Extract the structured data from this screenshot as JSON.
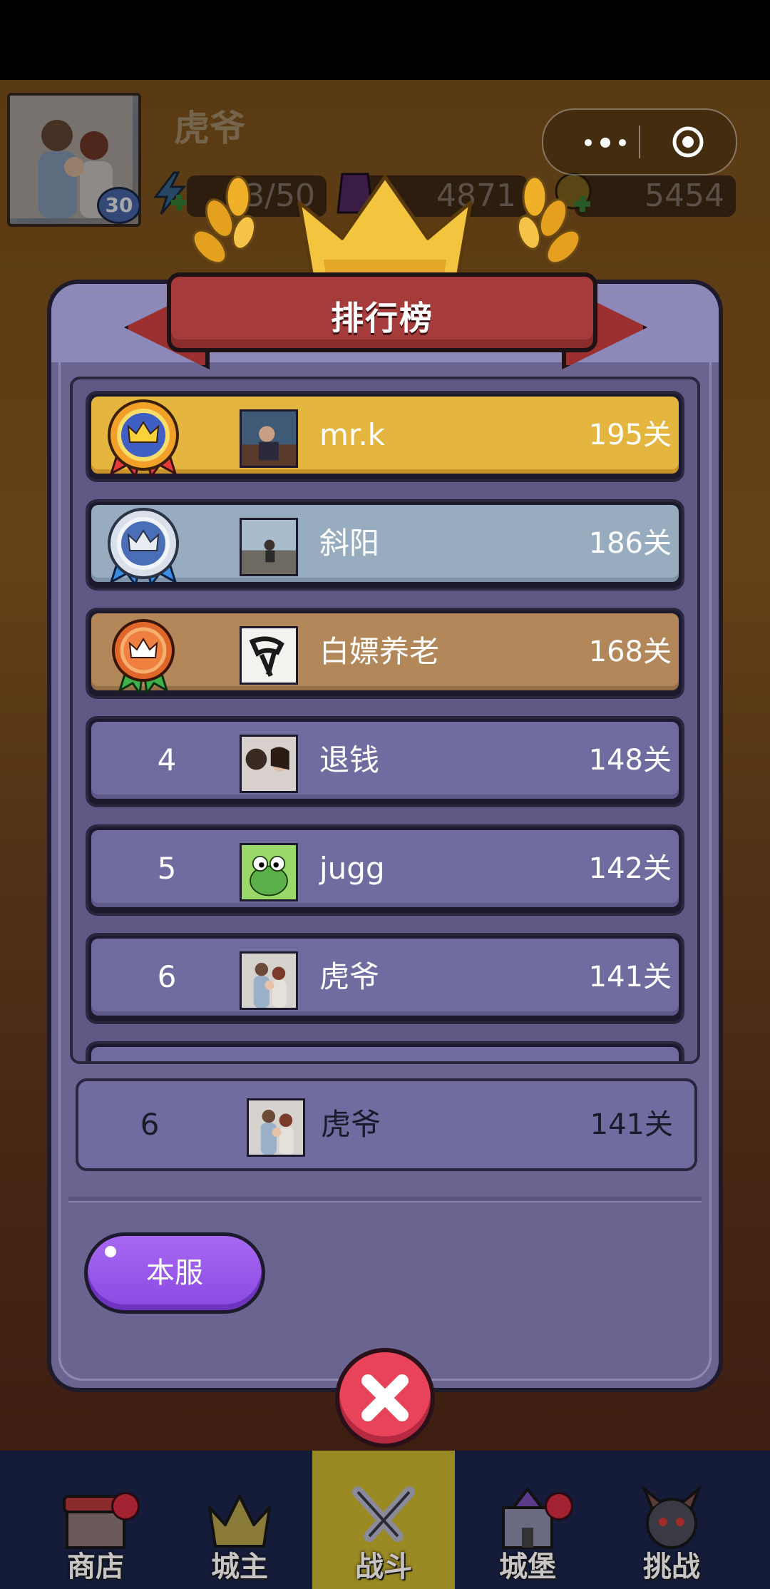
{
  "header": {
    "player_name": "虎爷",
    "level": "30",
    "energy": "3/50",
    "gems": "4871",
    "coins": "5454",
    "energy_icon": "lightning-plus-icon",
    "gem_icon": "gem-icon",
    "coin_icon": "coin-plus-icon"
  },
  "capsule": {
    "more_icon": "more-dots-icon",
    "close_icon": "target-circle-icon"
  },
  "modal": {
    "title": "排行榜",
    "tab_button": "本服",
    "close_icon": "close-x-icon",
    "rows": [
      {
        "rank": "1",
        "rank_icon": "gold-crown-medal-icon",
        "name": "mr.k",
        "score": "195关",
        "color": "#e4b63f"
      },
      {
        "rank": "2",
        "rank_icon": "silver-crown-medal-icon",
        "name": "斜阳",
        "score": "186关",
        "color": "#98acbf"
      },
      {
        "rank": "3",
        "rank_icon": "bronze-crown-medal-icon",
        "name": "白嫖养老",
        "score": "168关",
        "color": "#b2885a"
      },
      {
        "rank": "4",
        "name": "退钱",
        "score": "148关",
        "color": "#716ca0"
      },
      {
        "rank": "5",
        "name": "jugg",
        "score": "142关",
        "color": "#716ca0"
      },
      {
        "rank": "6",
        "name": "虎爷",
        "score": "141关",
        "color": "#716ca0"
      }
    ],
    "my_rank": {
      "rank": "6",
      "name": "虎爷",
      "score": "141关"
    }
  },
  "tabbar": {
    "items": [
      {
        "label": "商店",
        "icon": "shop-icon",
        "badge": true
      },
      {
        "label": "城主",
        "icon": "crown-icon",
        "badge": false
      },
      {
        "label": "战斗",
        "icon": "crossed-swords-icon",
        "badge": false,
        "active": true
      },
      {
        "label": "城堡",
        "icon": "castle-icon",
        "badge": true
      },
      {
        "label": "挑战",
        "icon": "demon-icon",
        "badge": false
      }
    ]
  }
}
